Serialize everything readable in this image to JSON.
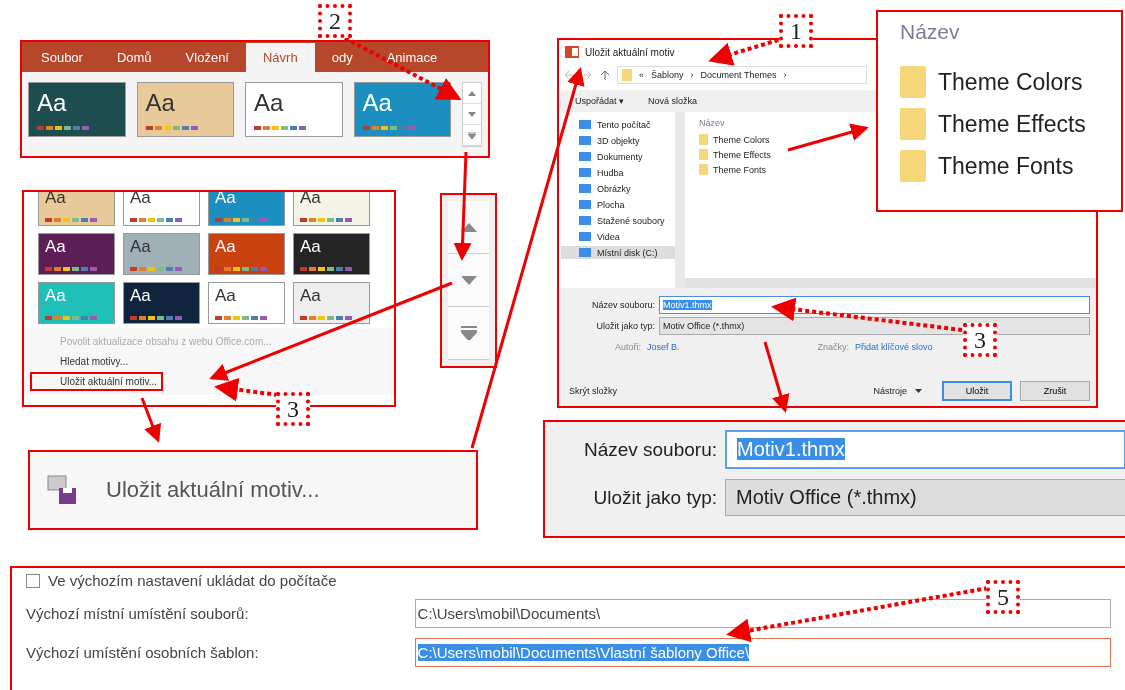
{
  "ribbon": {
    "tabs": [
      {
        "label": "Soubor",
        "selected": false
      },
      {
        "label": "Domů",
        "selected": false
      },
      {
        "label": "Vložení",
        "selected": false
      },
      {
        "label": "Návrh",
        "selected": true
      },
      {
        "label": "ody",
        "selected": false
      },
      {
        "label": "Animace",
        "selected": false
      }
    ],
    "themes": [
      {
        "label": "Aa",
        "color": "#1e4d4f"
      },
      {
        "label": "Aa",
        "color": "#e8c99a"
      },
      {
        "label": "Aa",
        "color": "#ffffff"
      },
      {
        "label": "Aa",
        "color": "#1a8fc0"
      }
    ]
  },
  "gallery": {
    "themes": [
      {
        "label": "Aa",
        "color": "#e8c99a"
      },
      {
        "label": "Aa",
        "color": "#ffffff"
      },
      {
        "label": "Aa",
        "color": "#1a8fc0"
      },
      {
        "label": "Aa",
        "color": "#f3f3e6"
      },
      {
        "label": "Aa",
        "color": "#5b1f56"
      },
      {
        "label": "Aa",
        "color": "#9fb0b7"
      },
      {
        "label": "Aa",
        "color": "#c9410f"
      },
      {
        "label": "Aa",
        "color": "#252525"
      },
      {
        "label": "Aa",
        "color": "#1fc0b8"
      },
      {
        "label": "Aa",
        "color": "#10243e"
      },
      {
        "label": "Aa",
        "color": "#ffffff"
      },
      {
        "label": "Aa",
        "color": "#eeeeee"
      }
    ],
    "menu": [
      {
        "label": "Povolit aktualizace obsahu z webu Office.com...",
        "disabled": true,
        "highlighted": false
      },
      {
        "label": "Hledat motivy...",
        "disabled": false,
        "highlighted": false
      },
      {
        "label": "Uložit aktuální motiv...",
        "disabled": false,
        "highlighted": true
      }
    ]
  },
  "zoom_menu_item": {
    "label": "Uložit aktuální motiv..."
  },
  "dialog": {
    "title": "Uložit aktuální motiv",
    "path": [
      "«",
      "Šablony",
      "›",
      "Document Themes",
      "›"
    ],
    "toolbar": [
      "Uspořádat ▾",
      "Nová složka"
    ],
    "nav": [
      {
        "label": "Tento počítač",
        "selected": false
      },
      {
        "label": "3D objekty",
        "selected": false
      },
      {
        "label": "Dokumenty",
        "selected": false
      },
      {
        "label": "Hudba",
        "selected": false
      },
      {
        "label": "Obrázky",
        "selected": false
      },
      {
        "label": "Plocha",
        "selected": false
      },
      {
        "label": "Stažené soubory",
        "selected": false
      },
      {
        "label": "Videa",
        "selected": false
      },
      {
        "label": "Místní disk (C:)",
        "selected": true
      }
    ],
    "column_header": "Název",
    "folders": [
      "Theme Colors",
      "Theme Effects",
      "Theme Fonts"
    ],
    "file_name_label": "Název souboru:",
    "file_name": "Motiv1.thmx",
    "type_label": "Uložit jako typ:",
    "type": "Motiv Office (*.thmx)",
    "authors_label": "Autoři:",
    "authors": "Josef B.",
    "tags_label": "Značky:",
    "tags": "Přidat klíčové slovo",
    "hide_folders": "Skrýt složky",
    "tools": "Nástroje",
    "save": "Uložit",
    "cancel": "Zrušit"
  },
  "zoom_folders": {
    "column_header": "Název",
    "folders": [
      "Theme Colors",
      "Theme Effects",
      "Theme Fonts"
    ]
  },
  "zoom_fields": {
    "file_name_label": "Název souboru:",
    "file_name": "Motiv1.thmx",
    "type_label": "Uložit jako typ:",
    "type": "Motiv Office (*.thmx)"
  },
  "options": {
    "checkbox": {
      "label": "Ve výchozím nastavení ukládat do počítače",
      "checked": false
    },
    "rows": [
      {
        "label": "Výchozí místní umístění souborů:",
        "value": "C:\\Users\\mobil\\Documents\\",
        "selected": false
      },
      {
        "label": "Výchozí umístění osobních šablon:",
        "value": "C:\\Users\\mobil\\Documents\\Vlastní šablony Office\\",
        "selected": true
      }
    ]
  },
  "callouts": [
    "1",
    "2",
    "3",
    "3",
    "5"
  ]
}
